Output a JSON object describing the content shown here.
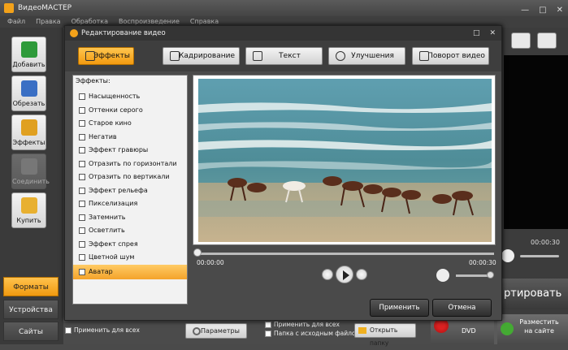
{
  "app": {
    "title": "ВидеоМАСТЕР",
    "window_controls": [
      "—",
      "□",
      "✕"
    ]
  },
  "menu": [
    "Файл",
    "Правка",
    "Обработка",
    "Воспроизведение",
    "Справка"
  ],
  "sidebar": {
    "buttons": [
      {
        "label": "Добавить",
        "icon": "add-film-icon",
        "color": "#2e9a3a"
      },
      {
        "label": "Обрезать",
        "icon": "scissors-film-icon",
        "color": "#3a6fc4"
      },
      {
        "label": "Эффекты",
        "icon": "magic-wand-icon",
        "color": "#e0a020"
      },
      {
        "label": "Соединить",
        "icon": "join-icon",
        "color": "#888888"
      },
      {
        "label": "Купить",
        "icon": "key-icon",
        "color": "#e8b030"
      }
    ],
    "tabs": [
      "Форматы",
      "Устройства",
      "Сайты"
    ],
    "active_tab": "Форматы"
  },
  "right": {
    "time": "00:00:30",
    "convert_label": "ртировать",
    "share_label_1": "Разместить",
    "share_label_2": "на сайте",
    "dvd_label": "DVD"
  },
  "bottom": {
    "apply_all": "Применить для всех",
    "params": "Параметры",
    "apply_all_2": "Применить для всех",
    "with_source": "Папка с исходным файлом",
    "open_folder": "Открыть папку"
  },
  "dialog": {
    "title": "Редактирование видео",
    "controls": [
      "□",
      "✕"
    ],
    "tabs": [
      {
        "label": "Эффекты",
        "icon": "effects-icon"
      },
      {
        "label": "Кадрирование",
        "icon": "crop-icon"
      },
      {
        "label": "Текст",
        "icon": "text-icon"
      },
      {
        "label": "Улучшения",
        "icon": "sun-icon"
      },
      {
        "label": "Поворот видео",
        "icon": "rotate-icon"
      }
    ],
    "active_tab": "Эффекты",
    "effects_heading": "Эффекты:",
    "effects": [
      "Насыщенность",
      "Оттенки серого",
      "Старое кино",
      "Негатив",
      "Эффект гравюры",
      "Отразить по горизонтали",
      "Отразить по вертикали",
      "Эффект рельефа",
      "Пикселизация",
      "Затемнить",
      "Осветлить",
      "Эффект спрея",
      "Цветной шум",
      "Аватар"
    ],
    "selected_effect": "Аватар",
    "player": {
      "current": "00:00:00",
      "total": "00:00:30",
      "progress": 0,
      "volume": 0.95
    },
    "apply": "Применить",
    "cancel": "Отмена"
  }
}
